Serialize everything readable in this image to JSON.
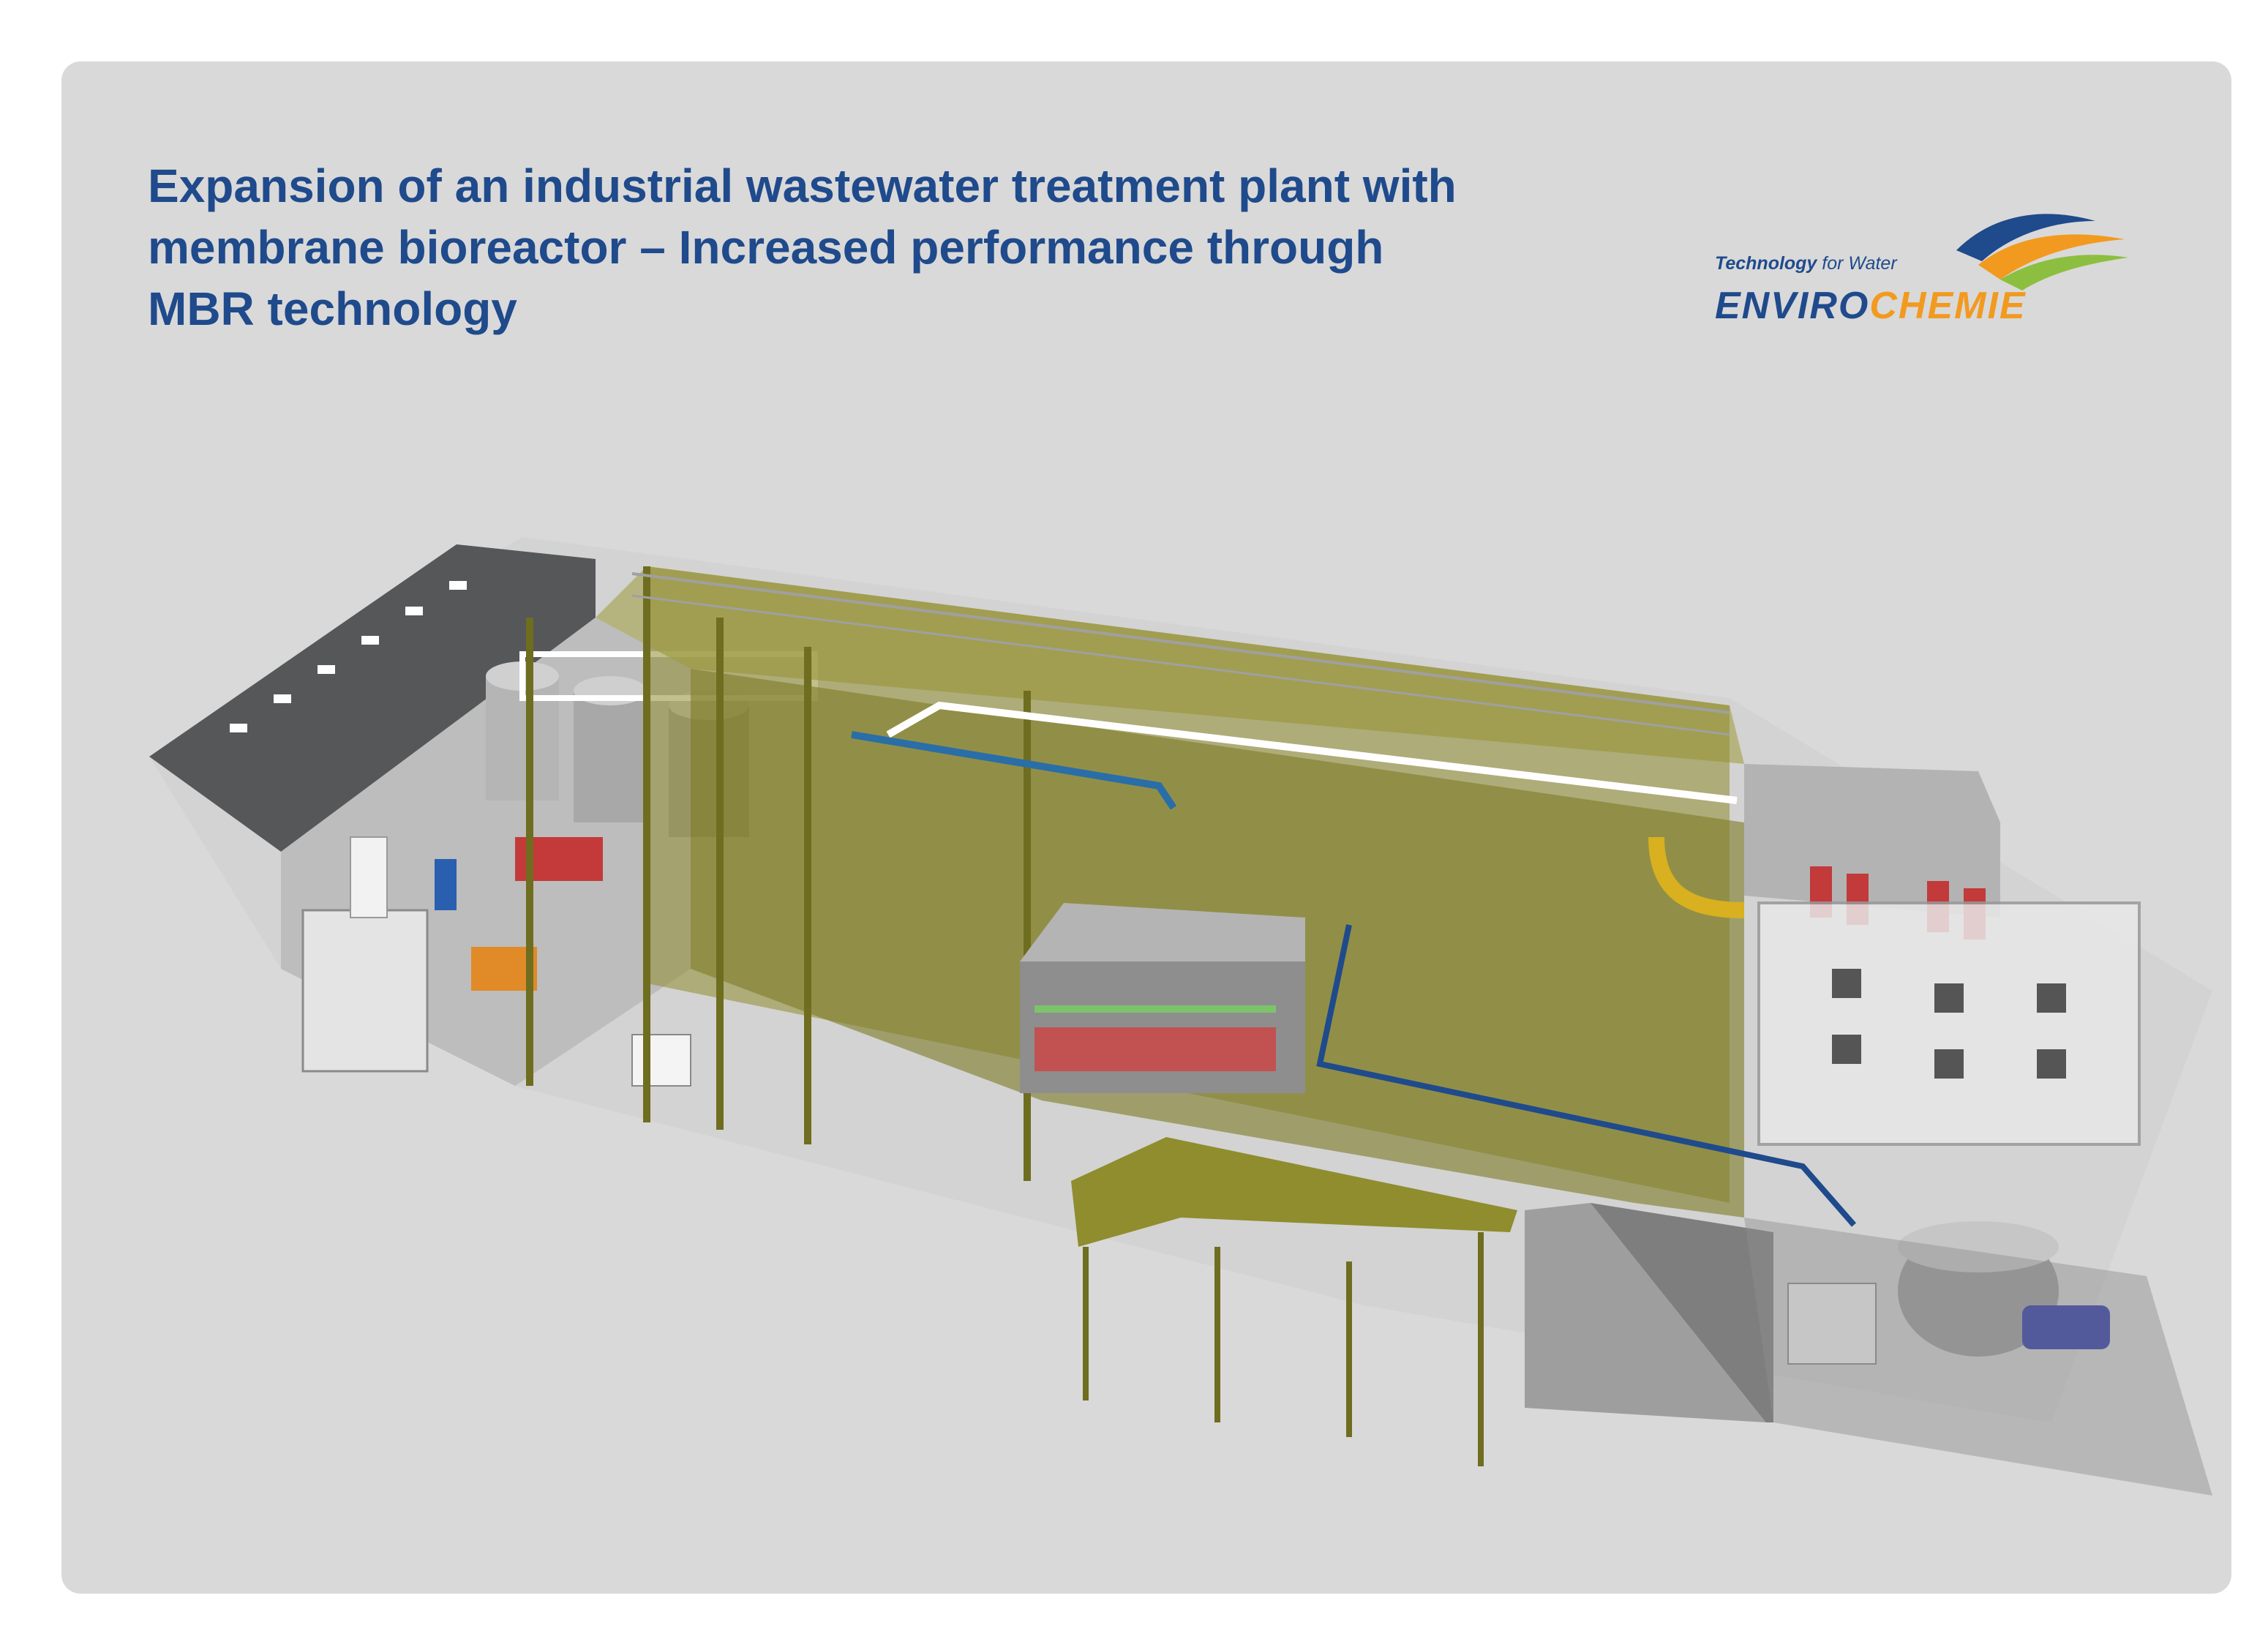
{
  "title": {
    "line1": "Expansion of an industrial wastewater treatment plant with",
    "line2": "membrane bioreactor – Increased performance through",
    "line3": "MBR technology"
  },
  "logo": {
    "tagline_bold": "Technology",
    "tagline_rest": " for Water",
    "name_part1": "ENVIRO",
    "name_part2": "CHEMIE"
  },
  "colors": {
    "background": "#d9d9d9",
    "title": "#1f4a8c",
    "brand_blue": "#1f4a8c",
    "brand_orange": "#f29a1f",
    "brand_green": "#8cbf3f",
    "tank_olive": "#8c8a2c",
    "pipe_blue": "#1f5a8c",
    "concrete_gray": "#8f8f8f"
  }
}
